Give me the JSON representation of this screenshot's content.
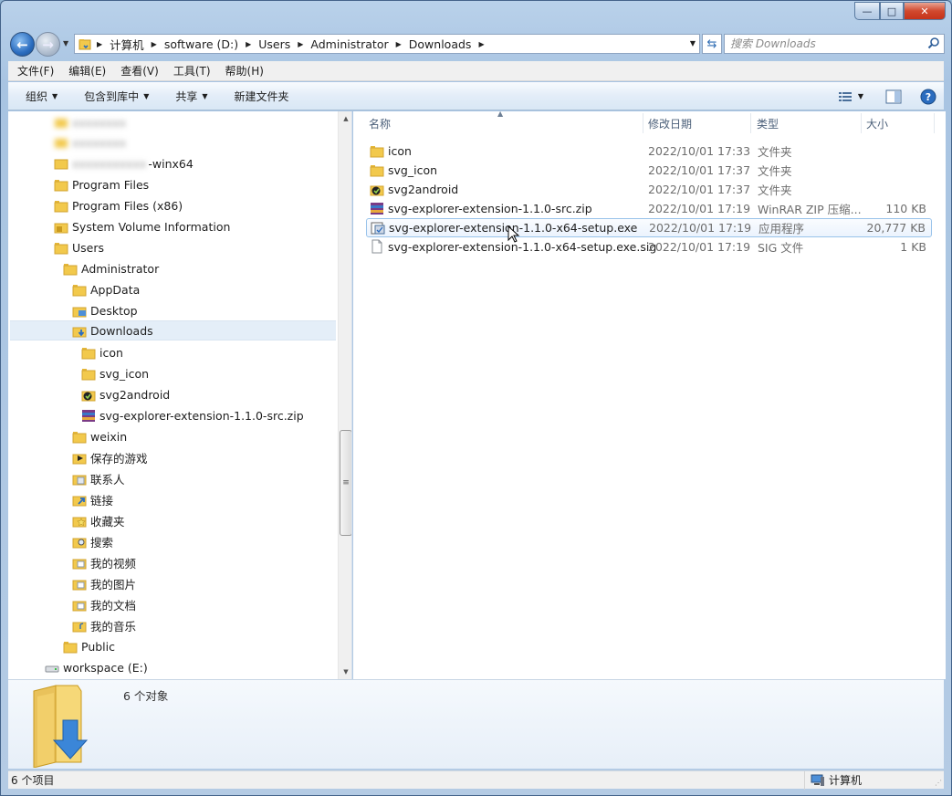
{
  "window": {
    "caption": {
      "min": "—",
      "max": "□",
      "close": "✕"
    }
  },
  "address": {
    "crumbs": [
      "计算机",
      "software (D:)",
      "Users",
      "Administrator",
      "Downloads"
    ],
    "search_placeholder": "搜索 Downloads"
  },
  "menubar": [
    "文件(F)",
    "编辑(E)",
    "查看(V)",
    "工具(T)",
    "帮助(H)"
  ],
  "toolbar": {
    "organize": "组织",
    "include_library": "包含到库中",
    "share": "共享",
    "new_folder": "新建文件夹"
  },
  "tree": {
    "blurred_item": "-winx64",
    "items": [
      {
        "label": "Program Files"
      },
      {
        "label": "Program Files (x86)"
      },
      {
        "label": "System Volume Information"
      },
      {
        "label": "Users"
      },
      {
        "label": "Administrator"
      },
      {
        "label": "AppData"
      },
      {
        "label": "Desktop"
      },
      {
        "label": "Downloads"
      },
      {
        "label": "icon"
      },
      {
        "label": "svg_icon"
      },
      {
        "label": "svg2android"
      },
      {
        "label": "svg-explorer-extension-1.1.0-src.zip"
      },
      {
        "label": "weixin"
      },
      {
        "label": "保存的游戏"
      },
      {
        "label": "联系人"
      },
      {
        "label": "链接"
      },
      {
        "label": "收藏夹"
      },
      {
        "label": "搜索"
      },
      {
        "label": "我的视频"
      },
      {
        "label": "我的图片"
      },
      {
        "label": "我的文档"
      },
      {
        "label": "我的音乐"
      },
      {
        "label": "Public"
      },
      {
        "label": "workspace (E:)"
      }
    ]
  },
  "columns": {
    "name": "名称",
    "modified": "修改日期",
    "type": "类型",
    "size": "大小"
  },
  "files": [
    {
      "name": "icon",
      "modified": "2022/10/01 17:33",
      "type": "文件夹",
      "size": ""
    },
    {
      "name": "svg_icon",
      "modified": "2022/10/01 17:37",
      "type": "文件夹",
      "size": ""
    },
    {
      "name": "svg2android",
      "modified": "2022/10/01 17:37",
      "type": "文件夹",
      "size": ""
    },
    {
      "name": "svg-explorer-extension-1.1.0-src.zip",
      "modified": "2022/10/01 17:19",
      "type": "WinRAR ZIP 压缩...",
      "size": "110 KB"
    },
    {
      "name": "svg-explorer-extension-1.1.0-x64-setup.exe",
      "modified": "2022/10/01 17:19",
      "type": "应用程序",
      "size": "20,777 KB"
    },
    {
      "name": "svg-explorer-extension-1.1.0-x64-setup.exe.sig",
      "modified": "2022/10/01 17:19",
      "type": "SIG 文件",
      "size": "1 KB"
    }
  ],
  "details": {
    "count": "6 个对象"
  },
  "status": {
    "items": "6 个项目",
    "location": "计算机"
  },
  "colors": {
    "folder": "#f2c94c",
    "accent": "#2a6cbf",
    "selection": "#e4eef8"
  }
}
